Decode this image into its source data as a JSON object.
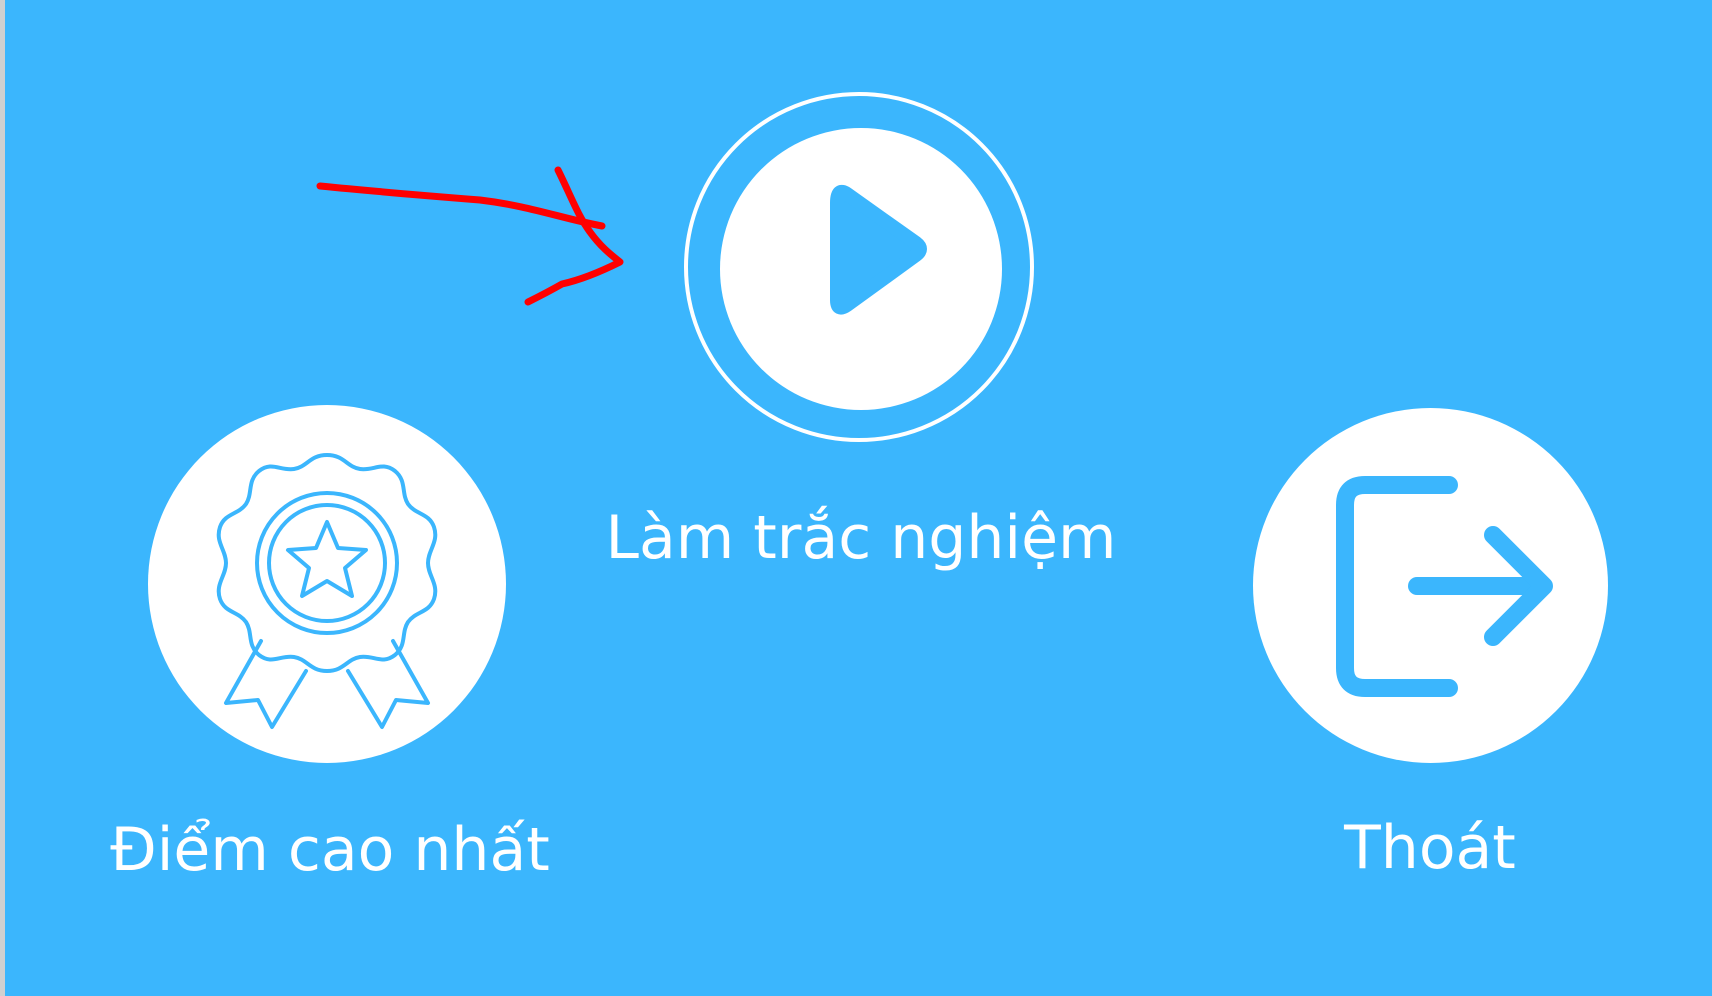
{
  "colors": {
    "background": "#3bb6fd",
    "button_fill": "#ffffff",
    "icon_stroke": "#3bb6fd",
    "annotation_arrow": "#ff0000"
  },
  "menu": {
    "play": {
      "label": "Làm trắc nghiệm",
      "icon": "play-icon"
    },
    "high_score": {
      "label": "Điểm cao nhất",
      "icon": "award-badge-icon"
    },
    "exit": {
      "label": "Thoát",
      "icon": "exit-icon"
    }
  },
  "annotation": {
    "icon": "red-arrow-annotation"
  }
}
